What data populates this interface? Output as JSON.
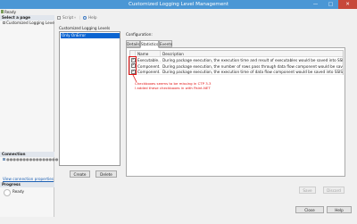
{
  "window": {
    "title": "Customized Logging Level Management",
    "icons": {
      "minimize": "minimize-icon",
      "maximize": "maximize-icon",
      "close": "close-icon"
    }
  },
  "status_text": "Ready",
  "left_pane": {
    "select_page_header": "Select a page",
    "page_item": "Customized Logging Leve",
    "connection_header": "Connection",
    "connection_value": "●●●●●●●●●●●●●●●●",
    "view_connection_link": "View connection properties",
    "progress_header": "Progress",
    "progress_status": "Ready"
  },
  "toolbar": {
    "script": "Script",
    "help": "Help"
  },
  "levels": {
    "header": "Customized Logging Levels",
    "items": [
      {
        "label": "Only OnError",
        "selected": true
      }
    ]
  },
  "buttons": {
    "create": "Create",
    "delete": "Delete",
    "save": "Save",
    "discard": "Discard",
    "close": "Close",
    "help": "Help"
  },
  "configuration": {
    "label": "Configuration:",
    "tabs": [
      {
        "label": "Details",
        "active": false
      },
      {
        "label": "Statistics",
        "active": true
      },
      {
        "label": "Events",
        "active": false
      }
    ],
    "columns": [
      "Name",
      "Description"
    ],
    "rows": [
      {
        "checked": true,
        "name": "Executable...",
        "description": "During package execution, the execution time and result of executables would be saved into SSISDB."
      },
      {
        "checked": true,
        "name": "Component...",
        "description": "During package execution, the number of rows pass through data flow component would be saved into SSISDB."
      },
      {
        "checked": true,
        "name": "Component...",
        "description": "During package execution, the execution time of data flow component would be saved into SSISDB."
      }
    ]
  },
  "annotation": {
    "line1": "Checkboxes seems to be missing in CTP 3.3",
    "line2": "I added these checkboxes in with Paint.NET",
    "color": "#e21414"
  }
}
